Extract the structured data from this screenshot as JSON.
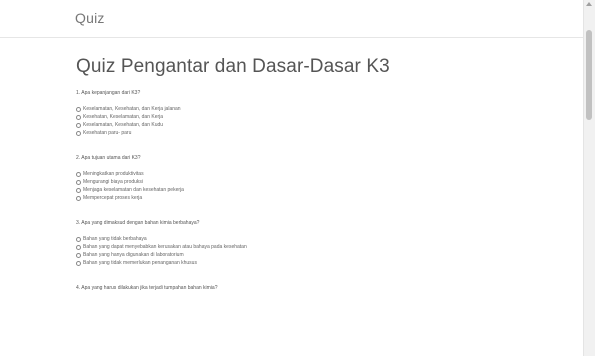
{
  "header": {
    "brand": "Quiz"
  },
  "page": {
    "title": "Quiz Pengantar dan Dasar-Dasar K3"
  },
  "questions": [
    {
      "text": "1. Apa kepanjangan dari K3?",
      "options": [
        "Keselamatan, Kesehatan, dan Kerja jalanan",
        "Kesehatan, Keselamatan, dan Kerja",
        "Keselamatan, Kesehatan, dan Kudu",
        "Kesehatan paru- paru"
      ]
    },
    {
      "text": "2. Apa tujuan utama dari K3?",
      "options": [
        "Meningkatkan produktivitas",
        "Mengurangi biaya produksi",
        "Menjaga keselamatan dan kesehatan pekerja",
        "Mempercepat proses kerja"
      ]
    },
    {
      "text": "3. Apa yang dimaksud dengan bahan kimia berbahaya?",
      "options": [
        "Bahan yang tidak berbahaya",
        "Bahan yang dapat menyebabkan kerusakan atau bahaya pada kesehatan",
        "Bahan yang hanya digunakan di laboratorium",
        "Bahan yang tidak memerlukan penanganan khusus"
      ]
    },
    {
      "text": "4. Apa yang harus dilakukan jika terjadi tumpahan bahan kimia?",
      "options": []
    }
  ]
}
